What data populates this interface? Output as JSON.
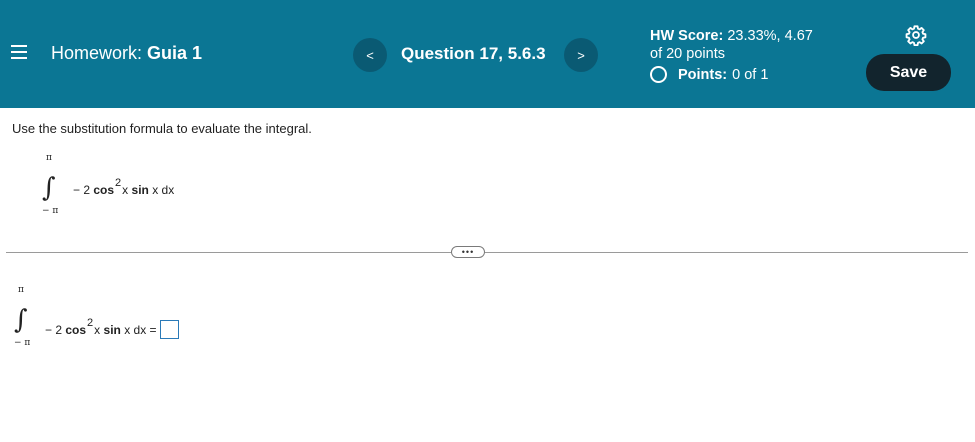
{
  "header": {
    "menu_icon": "hamburger-menu-icon",
    "homework_prefix": "Homework:",
    "homework_name": "Guia 1",
    "prev_symbol": "<",
    "next_symbol": ">",
    "question_label": "Question 17, 5.6.3",
    "hw_score_label": "HW Score:",
    "hw_score_value": "23.33%, 4.67",
    "hw_score_line2": "of 20 points",
    "points_label": "Points:",
    "points_value": "0 of 1",
    "settings_icon": "gear-icon",
    "save_label": "Save",
    "accent_color": "#0b7694",
    "save_color": "#12242d"
  },
  "problem": {
    "instructions": "Use the substitution formula to evaluate the integral.",
    "upper_limit": "π",
    "lower_limit": "− π",
    "integrand_prefix": "− 2",
    "cos": "cos",
    "exponent": "2",
    "x1": "x",
    "sin": "sin",
    "x2": "x dx"
  },
  "answer": {
    "upper_limit": "π",
    "lower_limit": "− π",
    "integrand_prefix": "− 2",
    "cos": "cos",
    "exponent": "2",
    "x1": "x",
    "sin": "sin",
    "x2": "x dx =",
    "input_value": ""
  },
  "divider": {
    "more_symbol": "•••"
  }
}
